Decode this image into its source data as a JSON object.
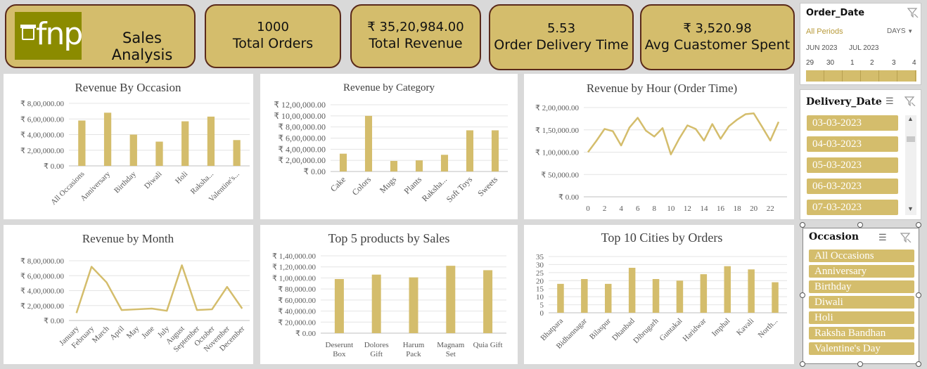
{
  "header": {
    "logo_text": "fnp",
    "title": "Sales Analysis",
    "kpis": [
      {
        "value": "1000",
        "label": "Total Orders"
      },
      {
        "value": "₹ 35,20,984.00",
        "label": "Total Revenue"
      },
      {
        "value": "5.53",
        "label": "Order Delivery Time"
      },
      {
        "value": "₹ 3,520.98",
        "label": "Avg Cuastomer Spent"
      }
    ]
  },
  "slicers": {
    "order_date": {
      "title": "Order_Date",
      "period_label": "All Periods",
      "level": "DAYS",
      "months": [
        "JUN 2023",
        "JUL 2023"
      ],
      "days": [
        "29",
        "30",
        "1",
        "2",
        "3",
        "4"
      ]
    },
    "delivery_date": {
      "title": "Delivery_Date",
      "items": [
        "03-03-2023",
        "04-03-2023",
        "05-03-2023",
        "06-03-2023",
        "07-03-2023"
      ]
    },
    "occasion": {
      "title": "Occasion",
      "items": [
        "All Occasions",
        "Anniversary",
        "Birthday",
        "Diwali",
        "Holi",
        "Raksha Bandhan",
        "Valentine's Day"
      ]
    }
  },
  "colors": {
    "gold": "#d4bd6c",
    "border": "#5a2a1a",
    "logo_bg": "#8b8b00"
  },
  "chart_data": [
    {
      "id": "occasion",
      "type": "bar",
      "title": "Revenue By Occasion",
      "categories": [
        "All Occasions",
        "Anniversary",
        "Birthday",
        "Diwali",
        "Holi",
        "Raksha...",
        "Valentine's..."
      ],
      "values": [
        580000,
        680000,
        400000,
        310000,
        570000,
        630000,
        330000
      ],
      "ylim": [
        0,
        800000
      ],
      "yticks": [
        0,
        200000,
        400000,
        600000,
        800000
      ],
      "ytick_labels": [
        "₹ 0.00",
        "₹ 2,00,000.00",
        "₹ 4,00,000.00",
        "₹ 6,00,000.00",
        "₹ 8,00,000.00"
      ]
    },
    {
      "id": "category",
      "type": "bar",
      "title": "Revenue by Category",
      "categories": [
        "Cake",
        "Colors",
        "Mugs",
        "Plants",
        "Raksha...",
        "Soft Toys",
        "Sweets"
      ],
      "values": [
        320000,
        1000000,
        190000,
        200000,
        300000,
        740000,
        740000
      ],
      "ylim": [
        0,
        1200000
      ],
      "yticks": [
        0,
        200000,
        400000,
        600000,
        800000,
        1000000,
        1200000
      ],
      "ytick_labels": [
        "₹ 0.00",
        "₹ 2,00,000.00",
        "₹ 4,00,000.00",
        "₹ 6,00,000.00",
        "₹ 8,00,000.00",
        "₹ 10,00,000.00",
        "₹ 12,00,000.00"
      ]
    },
    {
      "id": "hour",
      "type": "line",
      "title": "Revenue by Hour (Order Time)",
      "x": [
        0,
        1,
        2,
        3,
        4,
        5,
        6,
        7,
        8,
        9,
        10,
        11,
        12,
        13,
        14,
        15,
        16,
        17,
        18,
        19,
        20,
        21,
        22,
        23
      ],
      "values": [
        100000,
        125000,
        152000,
        147000,
        115000,
        155000,
        177000,
        148000,
        135000,
        154000,
        95000,
        130000,
        160000,
        152000,
        126000,
        163000,
        130000,
        158000,
        173000,
        185000,
        187000,
        157000,
        126000,
        168000
      ],
      "ylim": [
        0,
        200000
      ],
      "yticks": [
        0,
        50000,
        100000,
        150000,
        200000
      ],
      "ytick_labels": [
        "₹ 0.00",
        "₹ 50,000.00",
        "₹ 1,00,000.00",
        "₹ 1,50,000.00",
        "₹ 2,00,000.00"
      ],
      "xtick_labels": [
        "0",
        "2",
        "4",
        "6",
        "8",
        "10",
        "12",
        "14",
        "16",
        "18",
        "20",
        "22"
      ]
    },
    {
      "id": "month",
      "type": "line",
      "title": "Revenue by Month",
      "categories": [
        "January",
        "February",
        "March",
        "April",
        "May",
        "June",
        "July",
        "August",
        "September",
        "October",
        "November",
        "December"
      ],
      "values": [
        100000,
        720000,
        510000,
        140000,
        150000,
        160000,
        130000,
        740000,
        140000,
        150000,
        450000,
        160000
      ],
      "ylim": [
        0,
        800000
      ],
      "yticks": [
        0,
        200000,
        400000,
        600000,
        800000
      ],
      "ytick_labels": [
        "₹ 0.00",
        "₹ 2,00,000.00",
        "₹ 4,00,000.00",
        "₹ 6,00,000.00",
        "₹ 8,00,000.00"
      ]
    },
    {
      "id": "products",
      "type": "bar",
      "title": "Top 5 products by Sales",
      "categories": [
        "Deserunt Box",
        "Dolores Gift",
        "Harum Pack",
        "Magnam Set",
        "Quia Gift"
      ],
      "category_lines": [
        [
          "Deserunt",
          "Box"
        ],
        [
          "Dolores",
          "Gift"
        ],
        [
          "Harum",
          "Pack"
        ],
        [
          "Magnam",
          "Set"
        ],
        [
          "Quia Gift"
        ]
      ],
      "values": [
        98000,
        106000,
        101000,
        122000,
        114000
      ],
      "ylim": [
        0,
        140000
      ],
      "yticks": [
        0,
        20000,
        40000,
        60000,
        80000,
        100000,
        120000,
        140000
      ],
      "ytick_labels": [
        "₹ 0.00",
        "₹ 20,000.00",
        "₹ 40,000.00",
        "₹ 60,000.00",
        "₹ 80,000.00",
        "₹ 1,00,000.00",
        "₹ 1,20,000.00",
        "₹ 1,40,000.00"
      ]
    },
    {
      "id": "cities",
      "type": "bar",
      "title": "Top 10 Cities by Orders",
      "categories": [
        "Bhatpara",
        "Bidhannagar",
        "Bilaspur",
        "Dhanbad",
        "Dibrugarh",
        "Guntakal",
        "Haridwar",
        "Imphal",
        "Kavali",
        "North..."
      ],
      "values": [
        18,
        21,
        18,
        28,
        21,
        20,
        24,
        29,
        27,
        19
      ],
      "ylim": [
        0,
        35
      ],
      "yticks": [
        0,
        5,
        10,
        15,
        20,
        25,
        30,
        35
      ],
      "ytick_labels": [
        "0",
        "5",
        "10",
        "15",
        "20",
        "25",
        "30",
        "35"
      ]
    }
  ]
}
